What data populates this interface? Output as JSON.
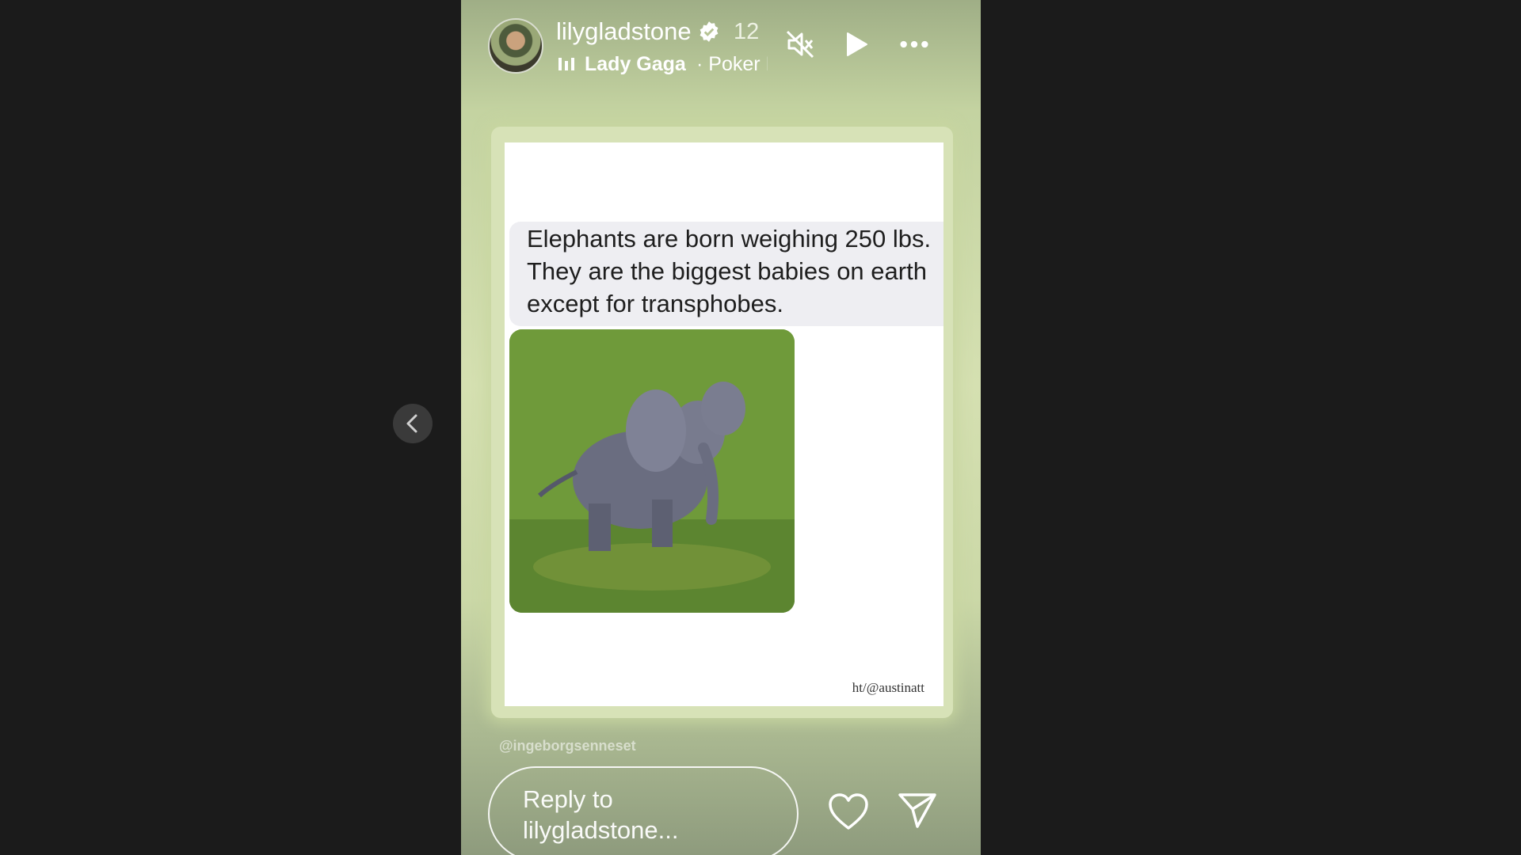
{
  "story": {
    "username": "lilygladstone",
    "time_ago": "12",
    "music_artist": "Lady Gaga",
    "music_song": "· Poker I",
    "post_text": "Elephants are born weighing 250 lbs. They are the biggest babies on earth except for transphobes.",
    "credit": "ht/@austinatt",
    "mention": "@ingeborgsenneset",
    "reply_placeholder": "Reply to lilygladstone..."
  },
  "icons": [
    "verified-badge-icon",
    "music-bars-icon",
    "mute-icon",
    "play-icon",
    "more-options-icon",
    "heart-icon",
    "send-icon",
    "chevron-left-icon"
  ],
  "colors": {
    "page_bg": "#1b1b1b",
    "story_tint": "#d5e0b1",
    "text_white": "#ffffff"
  }
}
